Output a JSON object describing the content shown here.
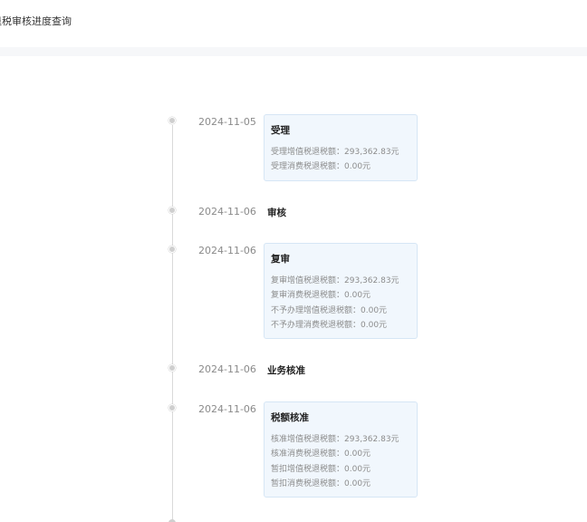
{
  "header": {
    "title": "退税审核进度查询"
  },
  "timeline": [
    {
      "date": "2024-11-05",
      "title": "受理",
      "lines": [
        {
          "label": "受理增值税退税额：",
          "value": "293,362.83元"
        },
        {
          "label": "受理消费税退税额：",
          "value": "0.00元"
        }
      ]
    },
    {
      "date": "2024-11-06",
      "title": "审核",
      "lines": []
    },
    {
      "date": "2024-11-06",
      "title": "复审",
      "lines": [
        {
          "label": "复审增值税退税额：",
          "value": "293,362.83元"
        },
        {
          "label": "复审消费税退税额：",
          "value": "0.00元"
        },
        {
          "label": "不予办理增值税退税额：",
          "value": "0.00元"
        },
        {
          "label": "不予办理消费税退税额：",
          "value": "0.00元"
        }
      ]
    },
    {
      "date": "2024-11-06",
      "title": "业务核准",
      "lines": []
    },
    {
      "date": "2024-11-06",
      "title": "税额核准",
      "lines": [
        {
          "label": "核准增值税退税额：",
          "value": "293,362.83元"
        },
        {
          "label": "核准消费税退税额：",
          "value": "0.00元"
        },
        {
          "label": "暂扣增值税退税额：",
          "value": "0.00元"
        },
        {
          "label": "暂扣消费税退税额：",
          "value": "0.00元"
        }
      ]
    }
  ]
}
